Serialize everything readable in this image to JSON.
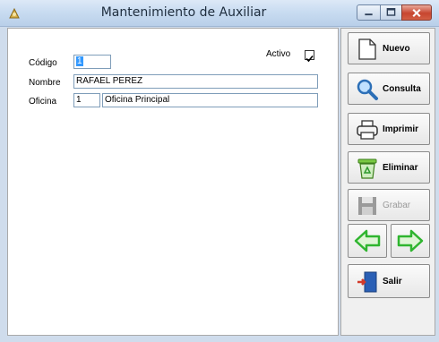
{
  "window": {
    "title": "Mantenimiento de Auxiliar"
  },
  "form": {
    "activo_label": "Activo",
    "activo_checked": true,
    "codigo_label": "Código",
    "codigo_value": "1",
    "nombre_label": "Nombre",
    "nombre_value": "RAFAEL PEREZ",
    "oficina_label": "Oficina",
    "oficina_code": "1",
    "oficina_name": "Oficina Principal"
  },
  "actions": {
    "nuevo": "Nuevo",
    "consulta": "Consulta",
    "imprimir": "Imprimir",
    "eliminar": "Eliminar",
    "grabar": "Grabar",
    "salir": "Salir"
  },
  "colors": {
    "nav_arrow": "#2fb52f",
    "selection": "#3399ff"
  }
}
